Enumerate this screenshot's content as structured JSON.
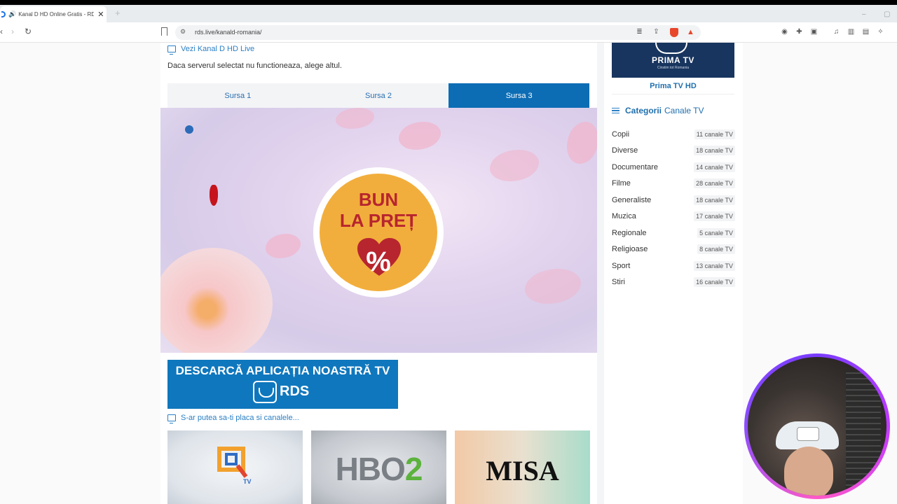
{
  "browser": {
    "tab_title": "Kanal D HD Online Gratis - RD",
    "tab_close": "✕",
    "new_tab": "+",
    "url": "rds.live/kanald-romania/",
    "window_min": "–",
    "window_max": "▢"
  },
  "main": {
    "live_label": "Vezi Kanal D HD Live",
    "server_note": "Daca serverul selectat nu functioneaza, alege altul.",
    "source_tabs": [
      {
        "label": "Sursa 1",
        "active": false
      },
      {
        "label": "Sursa 2",
        "active": false
      },
      {
        "label": "Sursa 3",
        "active": true
      }
    ],
    "player_badge": {
      "line1": "BUN",
      "line2": "LA PREȚ",
      "symbol": "%"
    },
    "promo": {
      "title": "DESCARCĂ APLICAȚIA NOASTRĂ TV",
      "brand": "RDS"
    },
    "suggest_label": "S-ar putea sa-ti placa si canalele...",
    "thumbnails": [
      {
        "name": "Q TV",
        "text": "TV"
      },
      {
        "name": "HBO 2",
        "text_main": "HBO",
        "text_num": "2"
      },
      {
        "name": "MISA",
        "text": "MISA"
      }
    ]
  },
  "sidebar": {
    "prima": {
      "logo": "PRIMA TV",
      "sub": "Cinstim tot Romania",
      "name": "Prima TV HD"
    },
    "categories_title": "Categorii",
    "categories_title2": "Canale TV",
    "categories": [
      {
        "name": "Copii",
        "count": "11 canale TV"
      },
      {
        "name": "Diverse",
        "count": "18 canale TV"
      },
      {
        "name": "Documentare",
        "count": "14 canale TV"
      },
      {
        "name": "Filme",
        "count": "28 canale TV"
      },
      {
        "name": "Generaliste",
        "count": "18 canale TV"
      },
      {
        "name": "Muzica",
        "count": "17 canale TV"
      },
      {
        "name": "Regionale",
        "count": "5 canale TV"
      },
      {
        "name": "Religioase",
        "count": "8 canale TV"
      },
      {
        "name": "Sport",
        "count": "13 canale TV"
      },
      {
        "name": "Stiri",
        "count": "16 canale TV"
      }
    ]
  },
  "colors": {
    "accent": "#0c6db5",
    "link": "#2a7fc4",
    "shield": "#e8462b"
  }
}
